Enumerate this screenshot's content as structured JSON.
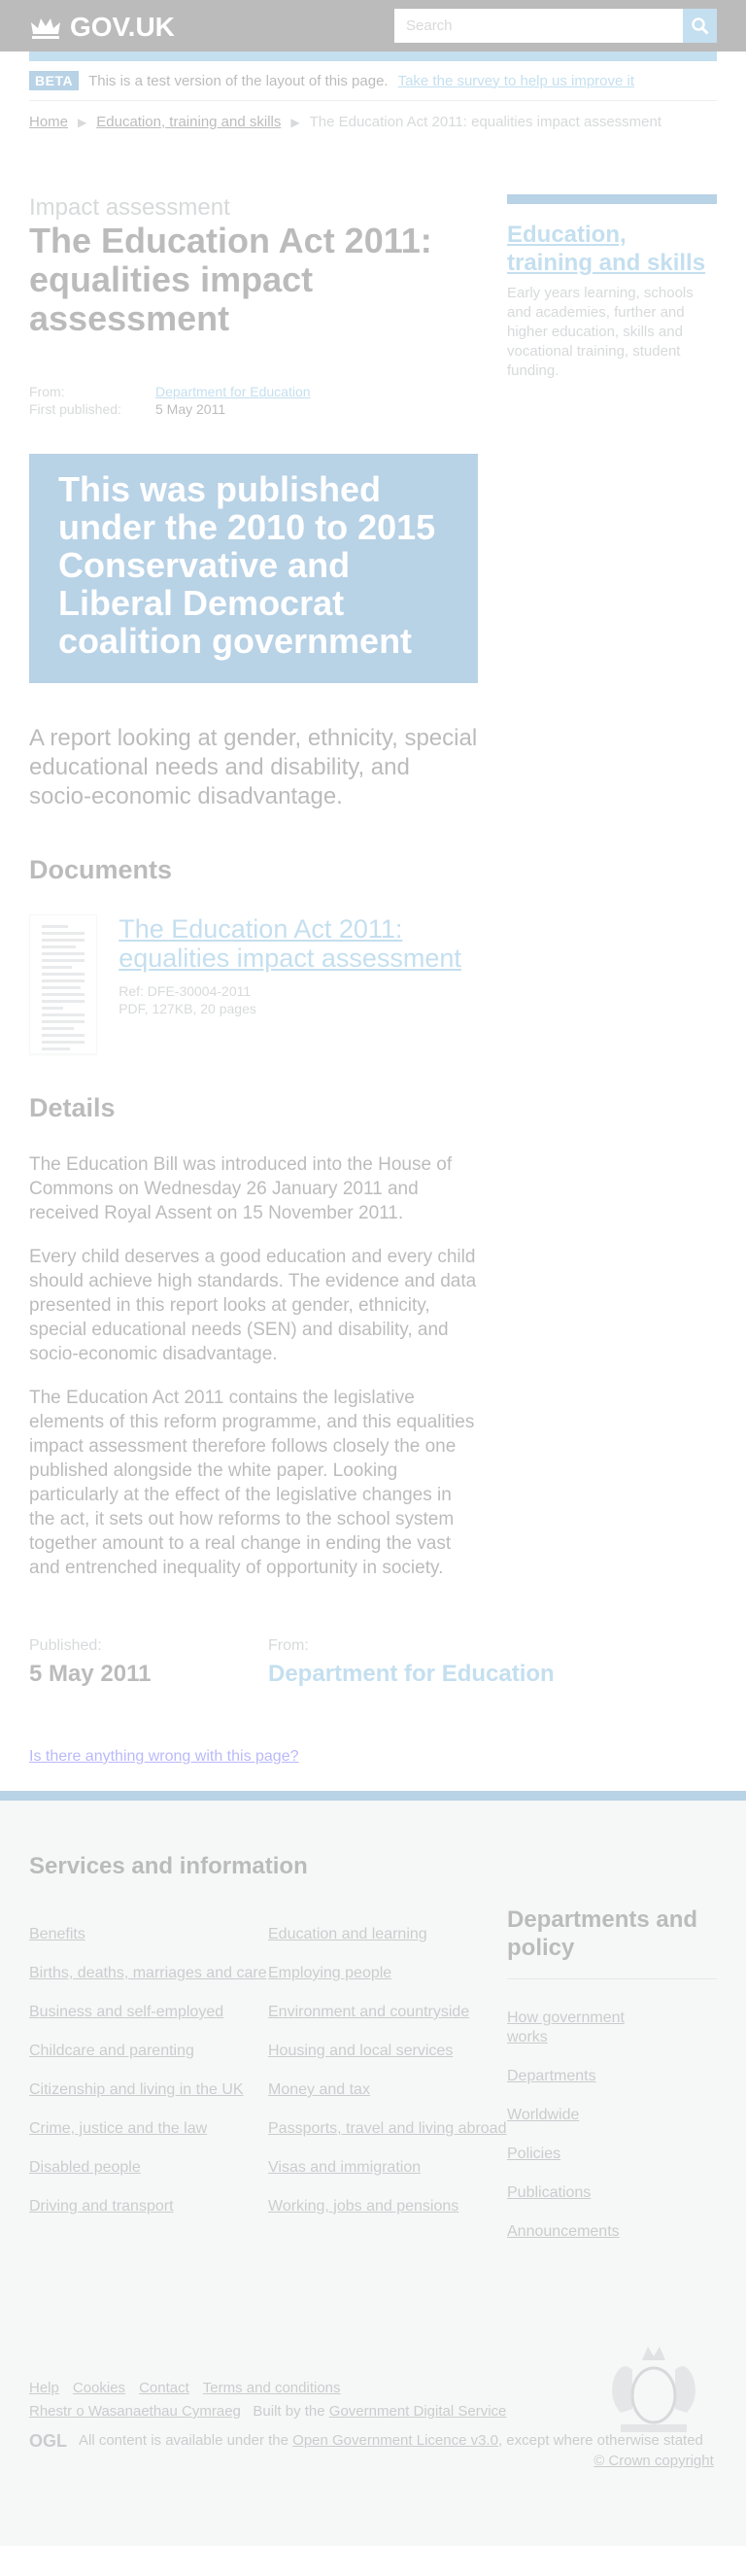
{
  "header": {
    "logo_text": "GOV.UK",
    "search_placeholder": "Search"
  },
  "beta": {
    "tag": "BETA",
    "text": "This is a test version of the layout of this page.",
    "link": "Take the survey to help us improve it"
  },
  "breadcrumbs": [
    "Home",
    "Education, training and skills",
    "The Education Act 2011: equalities impact assessment"
  ],
  "page": {
    "kicker": "Impact assessment",
    "title": "The Education Act 2011: equalities impact assessment",
    "from_label": "From:",
    "from_value": "Department for Education",
    "published_label": "First published:",
    "published_value": "5 May 2011",
    "history_banner": "This was published under the 2010 to 2015 Conservative and Liberal Democrat coalition government",
    "summary": "A report looking at gender, ethnicity, special educational needs and disability, and socio-economic disadvantage."
  },
  "documents": {
    "heading": "Documents",
    "items": [
      {
        "title": "The Education Act 2011: equalities impact assessment",
        "ref": "Ref: DFE-30004-2011",
        "info": "PDF, 127KB, 20 pages"
      }
    ]
  },
  "details": {
    "heading": "Details",
    "paragraphs": [
      "The Education Bill was introduced into the House of Commons on Wednesday 26 January 2011 and received Royal Assent on 15 November 2011.",
      "Every child deserves a good education and every child should achieve high standards. The evidence and data presented in this report looks at gender, ethnicity, special educational needs (SEN) and disability, and socio-economic disadvantage.",
      "The Education Act 2011 contains the legislative elements of this reform programme, and this equalities impact assessment therefore follows closely the one published alongside the white paper. Looking particularly at the effect of the legislative changes in the act, it sets out how reforms to the school system together amount to a real change in ending the vast and entrenched inequality of opportunity in society."
    ]
  },
  "published_footer": {
    "published_label": "Published:",
    "published_value": "5 May 2011",
    "from_label": "From:",
    "from_value": "Department for Education"
  },
  "feedback": {
    "link": "Is there anything wrong with this page?"
  },
  "sidebar": {
    "title": "Education, training and skills",
    "description": "Early years learning, schools and academies, further and higher education, skills and vocational training, student funding."
  },
  "footer": {
    "services_heading": "Services and information",
    "services_col1": [
      "Benefits",
      "Births, deaths, marriages and care",
      "Business and self-employed",
      "Childcare and parenting",
      "Citizenship and living in the UK",
      "Crime, justice and the law",
      "Disabled people",
      "Driving and transport"
    ],
    "services_col2": [
      "Education and learning",
      "Employing people",
      "Environment and countryside",
      "Housing and local services",
      "Money and tax",
      "Passports, travel and living abroad",
      "Visas and immigration",
      "Working, jobs and pensions"
    ],
    "departments_heading": "Departments and policy",
    "departments": [
      "How government works",
      "Departments",
      "Worldwide",
      "Policies",
      "Publications",
      "Announcements"
    ],
    "bottom_links": [
      "Help",
      "Cookies",
      "Contact",
      "Terms and conditions"
    ],
    "welsh_link": "Rhestr o Wasanaethau Cymraeg",
    "built_by_prefix": "Built by the",
    "built_by_link": "Government Digital Service",
    "ogl": "OGL",
    "licence_prefix": "All content is available under the",
    "licence_link": "Open Government Licence v3.0",
    "licence_suffix": ", except where otherwise stated",
    "copyright": "© Crown copyright"
  }
}
